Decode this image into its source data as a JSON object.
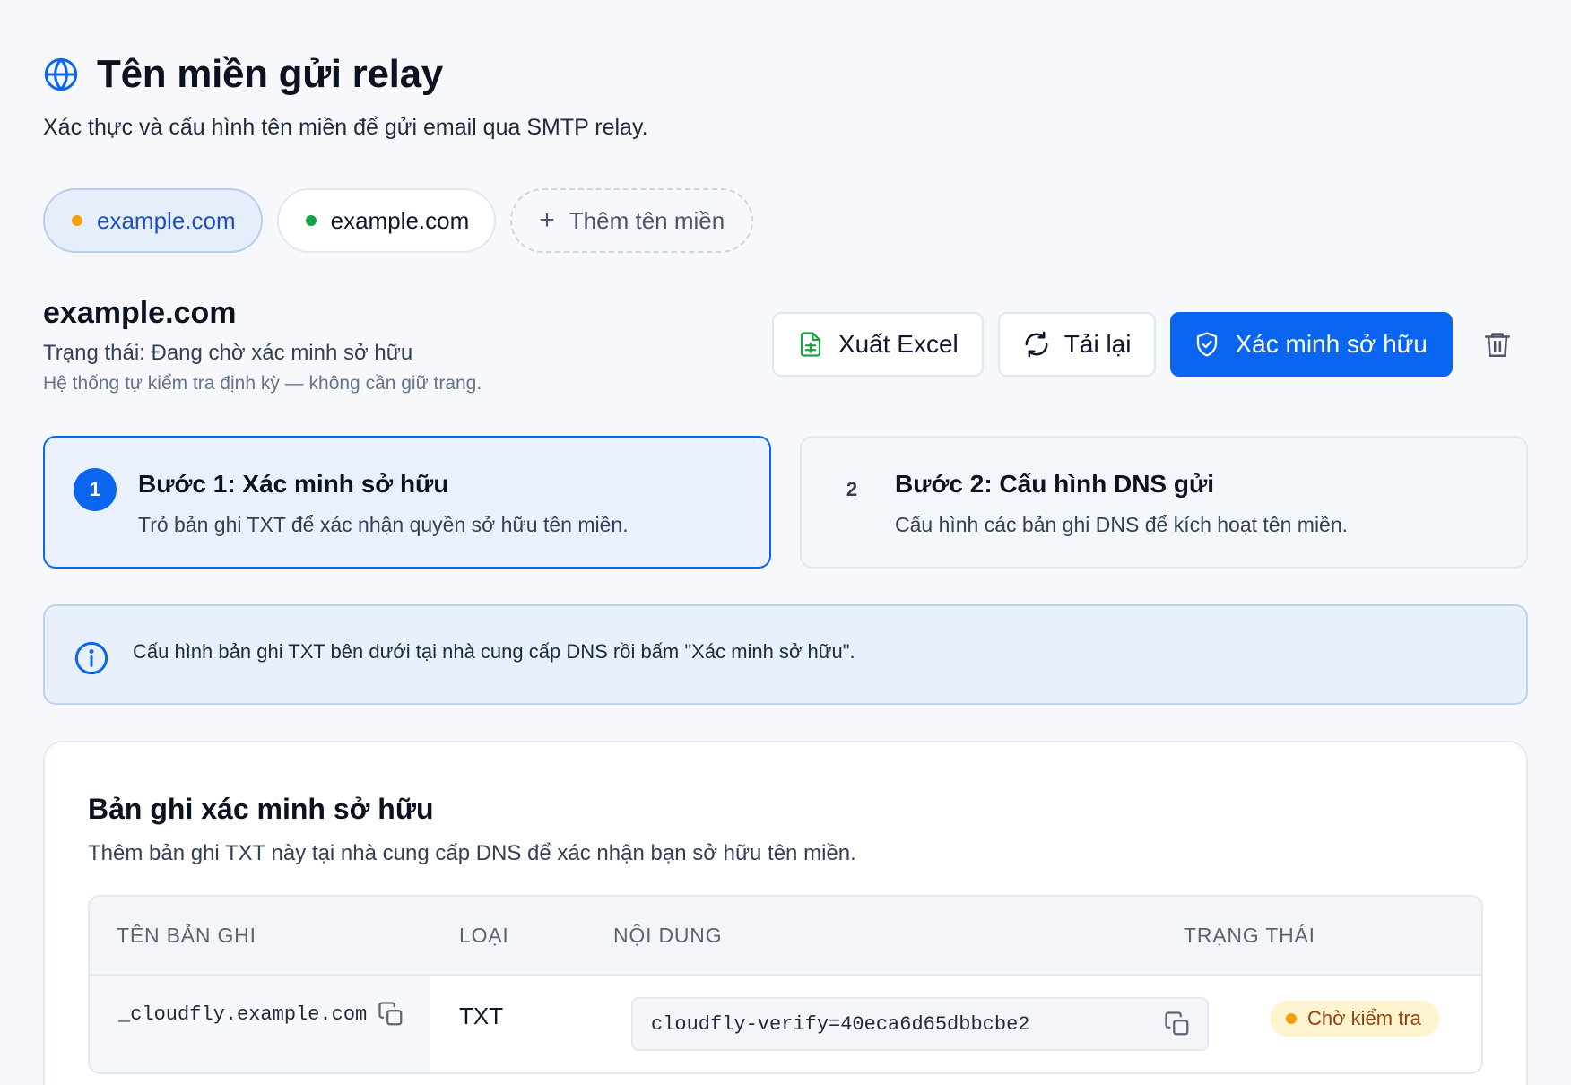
{
  "header": {
    "title": "Tên miền gửi relay",
    "subtitle": "Xác thực và cấu hình tên miền để gửi email qua SMTP relay."
  },
  "domain_tabs": [
    {
      "label": "example.com",
      "status_color": "#f59e0b",
      "active": true
    },
    {
      "label": "example.com",
      "status_color": "#16a34a",
      "active": false
    }
  ],
  "add_domain_label": "Thêm tên miền",
  "domain": {
    "name": "example.com",
    "status": "Trạng thái: Đang chờ xác minh sở hữu",
    "hint": "Hệ thống tự kiểm tra định kỳ — không cần giữ trang."
  },
  "actions": {
    "export_label": "Xuất Excel",
    "reload_label": "Tải lại",
    "verify_label": "Xác minh sở hữu"
  },
  "steps": [
    {
      "number": "1",
      "title": "Bước 1: Xác minh sở hữu",
      "description": "Trỏ bản ghi TXT để xác nhận quyền sở hữu tên miền.",
      "active": true
    },
    {
      "number": "2",
      "title": "Bước 2: Cấu hình DNS gửi",
      "description": "Cấu hình các bản ghi DNS để kích hoạt tên miền.",
      "active": false
    }
  ],
  "info_message": "Cấu hình bản ghi TXT bên dưới tại nhà cung cấp DNS rồi bấm \"Xác minh sở hữu\".",
  "card": {
    "title": "Bản ghi xác minh sở hữu",
    "description": "Thêm bản ghi TXT này tại nhà cung cấp DNS để xác nhận bạn sở hữu tên miền.",
    "table": {
      "headers": {
        "name": "TÊN BẢN GHI",
        "type": "LOẠI",
        "content": "NỘI DUNG",
        "status": "TRẠNG THÁI"
      },
      "rows": [
        {
          "name": "_cloudfly.example.com",
          "type": "TXT",
          "content": "cloudfly-verify=40eca6d65dbbcbe2",
          "status": "Chờ kiểm tra"
        }
      ]
    }
  },
  "colors": {
    "primary": "#0a66f0",
    "pending": "#f59e0b",
    "success": "#16a34a",
    "badge_bg": "#fdf3cf"
  }
}
